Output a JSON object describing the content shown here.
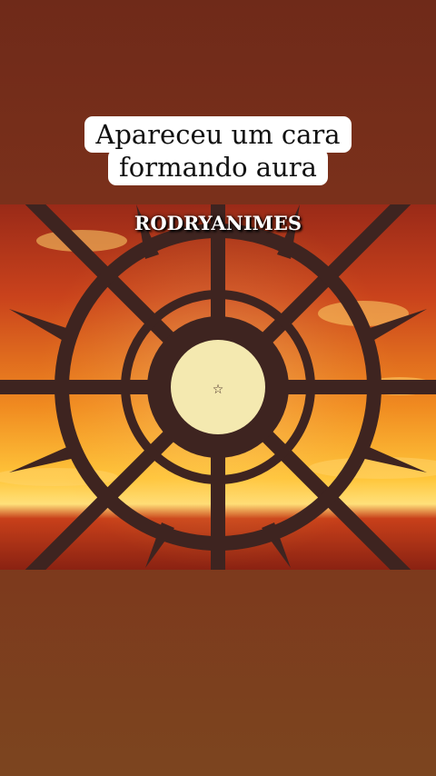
{
  "caption": {
    "line1": "Apareceu um cara",
    "line2": "formando aura"
  },
  "watermark": "RODRYANIMES",
  "scene": {
    "subject": "sun-wheel-emblem",
    "palette": {
      "sky_top": "#c0391b",
      "sky_mid": "#f08a20",
      "horizon": "#ffd34a",
      "sea": "#a62a15",
      "spokes": "#3e2420",
      "core": "#f4e9b0"
    }
  }
}
